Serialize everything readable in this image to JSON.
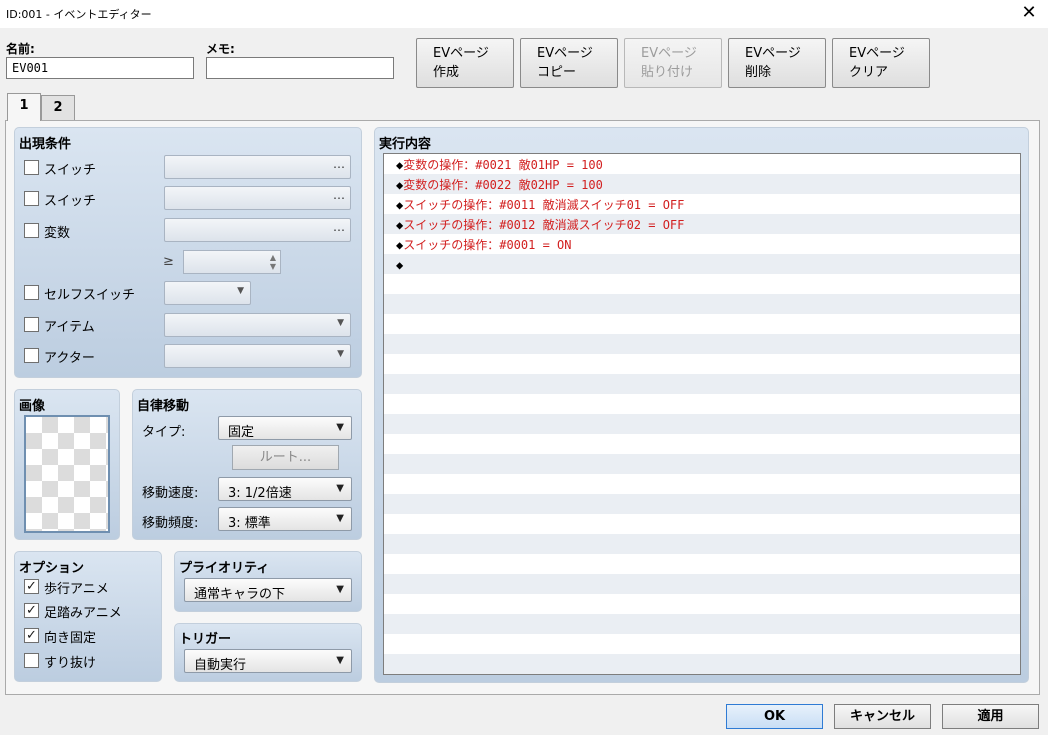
{
  "window": {
    "title": "ID:001 - イベントエディター",
    "close_glyph": "✕"
  },
  "name_field": {
    "label": "名前:",
    "value": "EV001"
  },
  "memo_field": {
    "label": "メモ:",
    "value": ""
  },
  "page_buttons": [
    {
      "line1": "EVページ",
      "line2": "作成",
      "enabled": true
    },
    {
      "line1": "EVページ",
      "line2": "コピー",
      "enabled": true
    },
    {
      "line1": "EVページ",
      "line2": "貼り付け",
      "enabled": false
    },
    {
      "line1": "EVページ",
      "line2": "削除",
      "enabled": true
    },
    {
      "line1": "EVページ",
      "line2": "クリア",
      "enabled": true
    }
  ],
  "tabs": [
    {
      "label": "1",
      "active": true
    },
    {
      "label": "2",
      "active": false
    }
  ],
  "conditions": {
    "title": "出現条件",
    "switch1_label": "スイッチ",
    "switch2_label": "スイッチ",
    "variable_label": "変数",
    "gte_symbol": "≥",
    "self_switch_label": "セルフスイッチ",
    "item_label": "アイテム",
    "actor_label": "アクター",
    "ellipsis": "…"
  },
  "image": {
    "title": "画像"
  },
  "autonomous": {
    "title": "自律移動",
    "type_label": "タイプ:",
    "type_value": "固定",
    "route_label": "ルート...",
    "speed_label": "移動速度:",
    "speed_value": "3: 1/2倍速",
    "freq_label": "移動頻度:",
    "freq_value": "3: 標準"
  },
  "options": {
    "title": "オプション",
    "items": [
      {
        "label": "歩行アニメ",
        "checked": true
      },
      {
        "label": "足踏みアニメ",
        "checked": true
      },
      {
        "label": "向き固定",
        "checked": true
      },
      {
        "label": "すり抜け",
        "checked": false
      }
    ],
    "check_glyph": "✓"
  },
  "priority": {
    "title": "プライオリティ",
    "value": "通常キャラの下"
  },
  "trigger": {
    "title": "トリガー",
    "value": "自動実行"
  },
  "contents": {
    "title": "実行内容",
    "diamond": "◆",
    "lines": [
      "変数の操作：#0021 敵01HP = 100",
      "変数の操作：#0022 敵02HP = 100",
      "スイッチの操作：#0011 敵消滅スイッチ01 = OFF",
      "スイッチの操作：#0012 敵消滅スイッチ02 = OFF",
      "スイッチの操作：#0001 = ON",
      ""
    ]
  },
  "dialog_buttons": {
    "ok": "OK",
    "cancel": "キャンセル",
    "apply": "適用"
  },
  "arrow_glyph": "▼",
  "spin_up": "▲",
  "spin_down": "▼",
  "colors": {
    "command_text": "#d22020",
    "group_bg": "#c9d8ea",
    "default_button": "#c9def5"
  }
}
